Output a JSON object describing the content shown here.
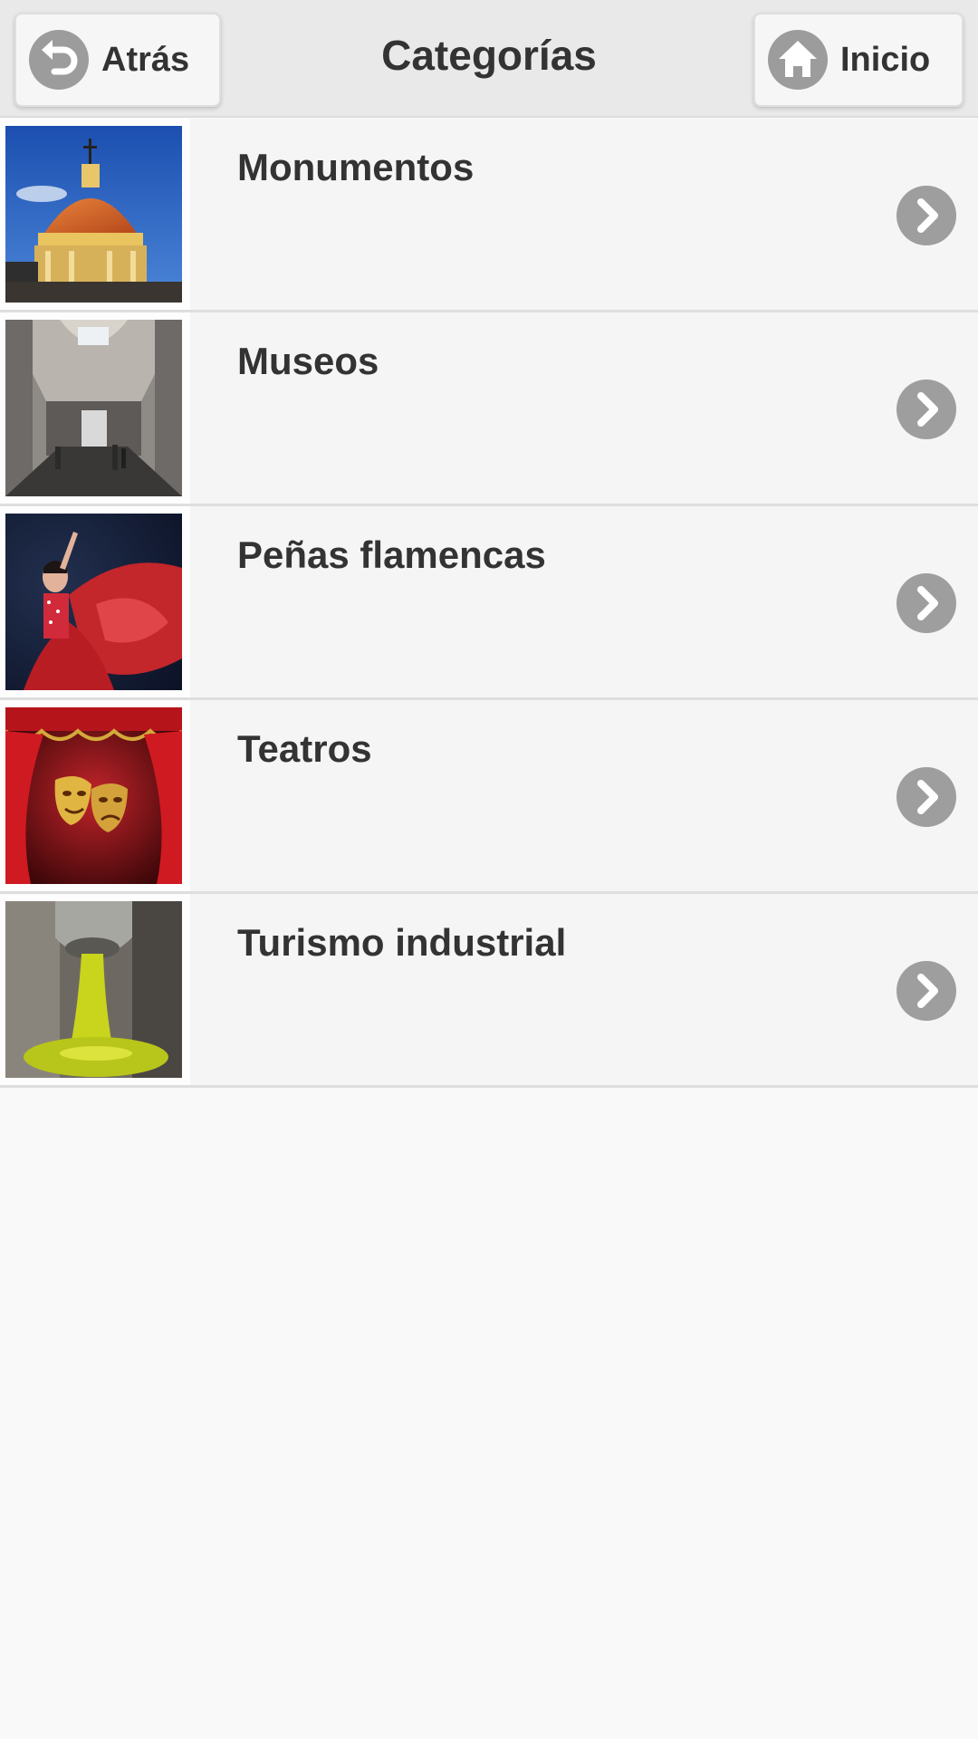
{
  "header": {
    "title": "Categorías",
    "back_label": "Atrás",
    "home_label": "Inicio"
  },
  "categories": [
    {
      "label": "Monumentos",
      "image": "dome-monument"
    },
    {
      "label": "Museos",
      "image": "museum-hall"
    },
    {
      "label": "Peñas flamencas",
      "image": "flamenco-dancer"
    },
    {
      "label": "Teatros",
      "image": "theater-masks"
    },
    {
      "label": "Turismo industrial",
      "image": "olive-oil-pour"
    }
  ],
  "colors": {
    "header_bg": "#e9e9e9",
    "row_bg": "#f5f5f5",
    "icon_gray": "#9e9e9e",
    "text": "#333333"
  },
  "icons": {
    "back": "back-arrow-icon",
    "home": "home-icon",
    "chevron": "chevron-right-icon"
  }
}
